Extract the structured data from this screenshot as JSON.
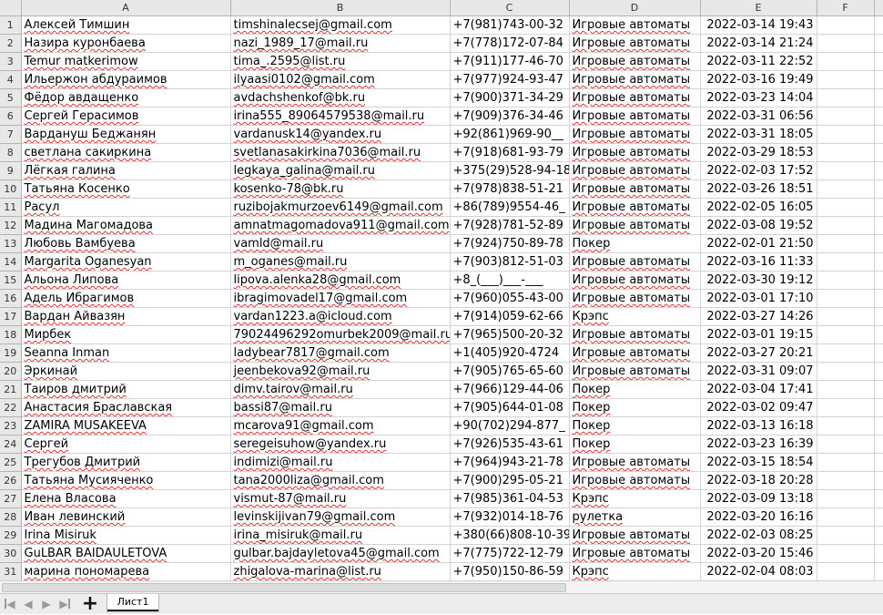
{
  "columns": [
    "A",
    "B",
    "C",
    "D",
    "E",
    "F"
  ],
  "rows": [
    {
      "num": "1",
      "name": "Алексей Тимшин",
      "email": "timshinalecsej@gmail.com",
      "phone": "+7(981)743-00-32",
      "category": "Игровые автоматы",
      "date": "2022-03-14 19:43"
    },
    {
      "num": "2",
      "name": "Назира куронбаева",
      "email": "nazi_1989_17@mail.ru",
      "phone": "+7(778)172-07-84",
      "category": "Игровые автоматы",
      "date": "2022-03-14 21:24"
    },
    {
      "num": "3",
      "name": "Temur matkerimow",
      "email": "tima_.2595@list.ru",
      "phone": "+7(911)177-46-70",
      "category": "Игровые автоматы",
      "date": "2022-03-11 22:52"
    },
    {
      "num": "4",
      "name": "Ильержон абдураимов",
      "email": "ilyaasi0102@gmail.com",
      "phone": "+7(977)924-93-47",
      "category": "Игровые автоматы",
      "date": "2022-03-16 19:49"
    },
    {
      "num": "5",
      "name": "Фёдор авдащенко",
      "email": "avdachshenkof@bk.ru",
      "phone": "+7(900)371-34-29",
      "category": "Игровые автоматы",
      "date": "2022-03-23 14:04"
    },
    {
      "num": "6",
      "name": "Сергей Герасимов",
      "email": "irina555_89064579538@mail.ru",
      "phone": "+7(909)376-34-46",
      "category": "Игровые автоматы",
      "date": "2022-03-31 06:56"
    },
    {
      "num": "7",
      "name": "Вардануш Беджанян",
      "email": "vardanusk14@yandex.ru",
      "phone": "+92(861)969-90__",
      "category": "Игровые автоматы",
      "date": "2022-03-31 18:05"
    },
    {
      "num": "8",
      "name": "светлана сакиркина",
      "email": "svetlanasakirkina7036@mail.ru",
      "phone": "+7(918)681-93-79",
      "category": "Игровые автоматы",
      "date": "2022-03-29 18:53"
    },
    {
      "num": "9",
      "name": "Лёгкая галина",
      "email": "legkaya_galina@mail.ru",
      "phone": "+375(29)528-94-18",
      "category": "Игровые автоматы",
      "date": "2022-02-03 17:52"
    },
    {
      "num": "10",
      "name": "Татьяна Косенко",
      "email": "kosenko-78@bk.ru",
      "phone": "+7(978)838-51-21",
      "category": "Игровые автоматы",
      "date": "2022-03-26 18:51"
    },
    {
      "num": "11",
      "name": "Расул",
      "email": "ruzibojakmurzoev6149@gmail.com",
      "phone": "+86(789)9554-46_",
      "category": "Игровые автоматы",
      "date": "2022-02-05 16:05"
    },
    {
      "num": "12",
      "name": "Мадина Магомадова",
      "email": "amnatmagomadova911@gmail.com",
      "phone": "+7(928)781-52-89",
      "category": "Игровые автоматы",
      "date": "2022-03-08 19:52"
    },
    {
      "num": "13",
      "name": "Любовь Вамбуева",
      "email": "vamld@mail.ru",
      "phone": "+7(924)750-89-78",
      "category": "Покер",
      "date": "2022-02-01 21:50"
    },
    {
      "num": "14",
      "name": "Margarita Oganesyan",
      "email": "m_oganes@mail.ru",
      "phone": "+7(903)812-51-03",
      "category": "Игровые автоматы",
      "date": "2022-03-16 11:33"
    },
    {
      "num": "15",
      "name": "Альона Липова",
      "email": "lipova.alenka28@gmail.com",
      "phone": "+8_(___)___-___",
      "category": "Игровые автоматы",
      "date": "2022-03-30 19:12"
    },
    {
      "num": "16",
      "name": "Адель Ибрагимов",
      "email": "ibragimovadel17@gmail.com",
      "phone": "+7(960)055-43-00",
      "category": "Игровые автоматы",
      "date": "2022-03-01 17:10"
    },
    {
      "num": "17",
      "name": "Вардан Айвазян",
      "email": "vardan1223.a@icloud.com",
      "phone": "+7(914)059-62-66",
      "category": "Крэпс",
      "date": "2022-03-27 14:26"
    },
    {
      "num": "18",
      "name": "Мирбек",
      "email": "79024496292omurbek2009@mail.ru",
      "phone": "+7(965)500-20-32",
      "category": "Игровые автоматы",
      "date": "2022-03-01 19:15"
    },
    {
      "num": "19",
      "name": "Seanna Inman",
      "email": "ladybear7817@gmail.com",
      "phone": "+1(405)920-4724",
      "category": "Игровые автоматы",
      "date": "2022-03-27 20:21"
    },
    {
      "num": "20",
      "name": "Эркинай",
      "email": "jeenbekova92@mail.ru",
      "phone": "+7(905)765-65-60",
      "category": "Игровые автоматы",
      "date": "2022-03-31 09:07"
    },
    {
      "num": "21",
      "name": "Таиров дмитрий",
      "email": "dimv.tairov@mail.ru",
      "phone": "+7(966)129-44-06",
      "category": "Покер",
      "date": "2022-03-04 17:41"
    },
    {
      "num": "22",
      "name": "Анастасия Браславская",
      "email": "bassi87@mail.ru",
      "phone": "+7(905)644-01-08",
      "category": "Покер",
      "date": "2022-03-02 09:47"
    },
    {
      "num": "23",
      "name": "ZAMIRA MUSAKEEVA",
      "email": "mcarova91@gmail.com",
      "phone": "+90(702)294-877_",
      "category": "Покер",
      "date": "2022-03-13 16:18"
    },
    {
      "num": "24",
      "name": "Сергей",
      "email": "seregeisuhow@yandex.ru",
      "phone": "+7(926)535-43-61",
      "category": "Покер",
      "date": "2022-03-23 16:39"
    },
    {
      "num": "25",
      "name": "Трегубов Дмитрий",
      "email": "indimizi@mail.ru",
      "phone": "+7(964)943-21-78",
      "category": "Игровые автоматы",
      "date": "2022-03-15 18:54"
    },
    {
      "num": "26",
      "name": "Татьяна Мусияченко",
      "email": "tana2000liza@gmail.com",
      "phone": "+7(900)295-05-21",
      "category": "Игровые автоматы",
      "date": "2022-03-18 20:28"
    },
    {
      "num": "27",
      "name": "Елена Власова",
      "email": "vismut-87@mail.ru",
      "phone": "+7(985)361-04-53",
      "category": "Крэпс",
      "date": "2022-03-09 13:18"
    },
    {
      "num": "28",
      "name": "Иван левинский",
      "email": "levinskijivan79@gmail.com",
      "phone": "+7(932)014-18-76",
      "category": "рулетка",
      "date": "2022-03-20 16:16"
    },
    {
      "num": "29",
      "name": "Irina Misiruk",
      "email": "irina_misiruk@mail.ru",
      "phone": "+380(66)808-10-39",
      "category": "Игровые автоматы",
      "date": "2022-02-03 08:25"
    },
    {
      "num": "30",
      "name": "GuLBAR BAIDAULETOVA",
      "email": "gulbar.bajdayletova45@gmail.com",
      "phone": "+7(775)722-12-79",
      "category": "Игровые автоматы",
      "date": "2022-03-20 15:46"
    },
    {
      "num": "31",
      "name": "марина пономарева",
      "email": "zhigalova-marina@list.ru",
      "phone": "+7(950)150-86-59",
      "category": "Крэпс",
      "date": "2022-02-04 08:03"
    }
  ],
  "tabbar": {
    "add_sheet_label": "+",
    "sheet_tab_label": "Лист1"
  },
  "icons": [
    "first-sheet-icon",
    "prev-sheet-icon",
    "next-sheet-icon",
    "last-sheet-icon",
    "add-sheet-icon"
  ]
}
